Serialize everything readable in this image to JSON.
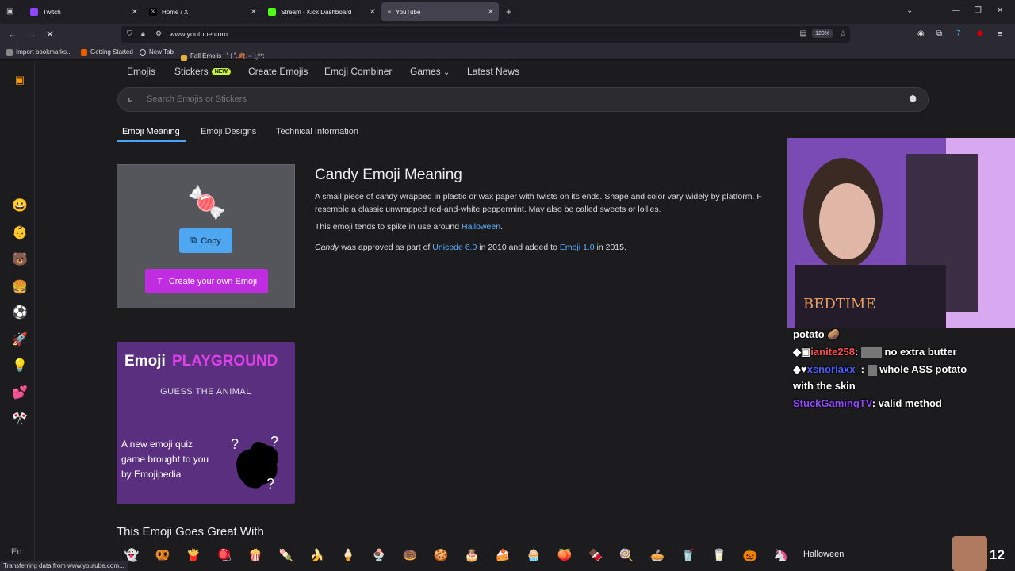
{
  "tabs": [
    {
      "label": "Twitch",
      "color": "#9146ff"
    },
    {
      "label": "Home / X",
      "color": "#ffffff"
    },
    {
      "label": "Stream - Kick Dashboard",
      "color": "#53fc18"
    },
    {
      "label": "YouTube",
      "color": "#888888"
    }
  ],
  "url": "www.youtube.com",
  "zoom": "120%",
  "bookmarks": [
    "Import bookmarks...",
    "Getting Started",
    "New Tab",
    "Fall Emojis | ˚⊹˚.🍂.⋆ೃ࿔*:"
  ],
  "nav": {
    "emojis": "Emojis",
    "stickers": "Stickers",
    "new_badge": "NEW",
    "create": "Create Emojis",
    "combiner": "Emoji Combiner",
    "games": "Games",
    "news": "Latest News"
  },
  "search": {
    "placeholder": "Search Emojis or Stickers"
  },
  "subtabs": [
    "Emoji Meaning",
    "Emoji Designs",
    "Technical Information"
  ],
  "emoji": {
    "glyph": "🍬"
  },
  "buttons": {
    "copy": "Copy",
    "create": "Create your own Emoji"
  },
  "title": "Candy Emoji Meaning",
  "description": {
    "line1": "A small piece of candy wrapped in plastic or wax paper with twists on its ends. Shape and color vary widely by platform. F",
    "line2": "resemble a classic unwrapped red-and-white peppermint. May also be called sweets or lollies.",
    "spike_pre": "This emoji tends to spike in use around ",
    "spike_link": "Halloween",
    "spike_post": ".",
    "approved_name": "Candy",
    "approved_pre": " was approved as part of ",
    "unicode_link": "Unicode 6.0",
    "approved_mid": " in 2010 and added to ",
    "emoji_link": "Emoji 1.0",
    "approved_post": " in 2015."
  },
  "promo": {
    "emoji": "Emoji",
    "playground": "PLAYGROUND",
    "subtitle": "GUESS THE ANIMAL",
    "desc": "A new emoji quiz game brought to you by Emojipedia"
  },
  "goes_with": {
    "title": "This Emoji Goes Great With",
    "emojis": [
      "👻",
      "🥨",
      "🍟",
      "🪀",
      "🍿",
      "🍡",
      "🍌",
      "🍦",
      "🍨",
      "🍩",
      "🍪",
      "🎂",
      "🍰",
      "🧁",
      "🍑",
      "🍫",
      "🍭",
      "🥧",
      "🥤",
      "🥛",
      "🎃",
      "🦄",
      "🎃"
    ],
    "trailing_label": "Halloween"
  },
  "sidebar_emojis": [
    "😀",
    "👶",
    "🐻",
    "🍔",
    "⚽",
    "🚀",
    "💡",
    "💕",
    "🎌"
  ],
  "chat": {
    "line0": "potato 🥔",
    "user1": "ianite258",
    "msg1": "no extra butter",
    "user2": "xsnorlaxx_",
    "msg2": "whole  ASS  potato",
    "msg2b": "with the skin",
    "user3": "StuckGamingTV",
    "msg3": "valid method",
    "user1_color": "#ff4d4d",
    "user2_color": "#4d5cff",
    "user3_color": "#9147ff"
  },
  "viewer_count": "12",
  "lang": "En",
  "status": "Transferring data from www.youtube.com..."
}
